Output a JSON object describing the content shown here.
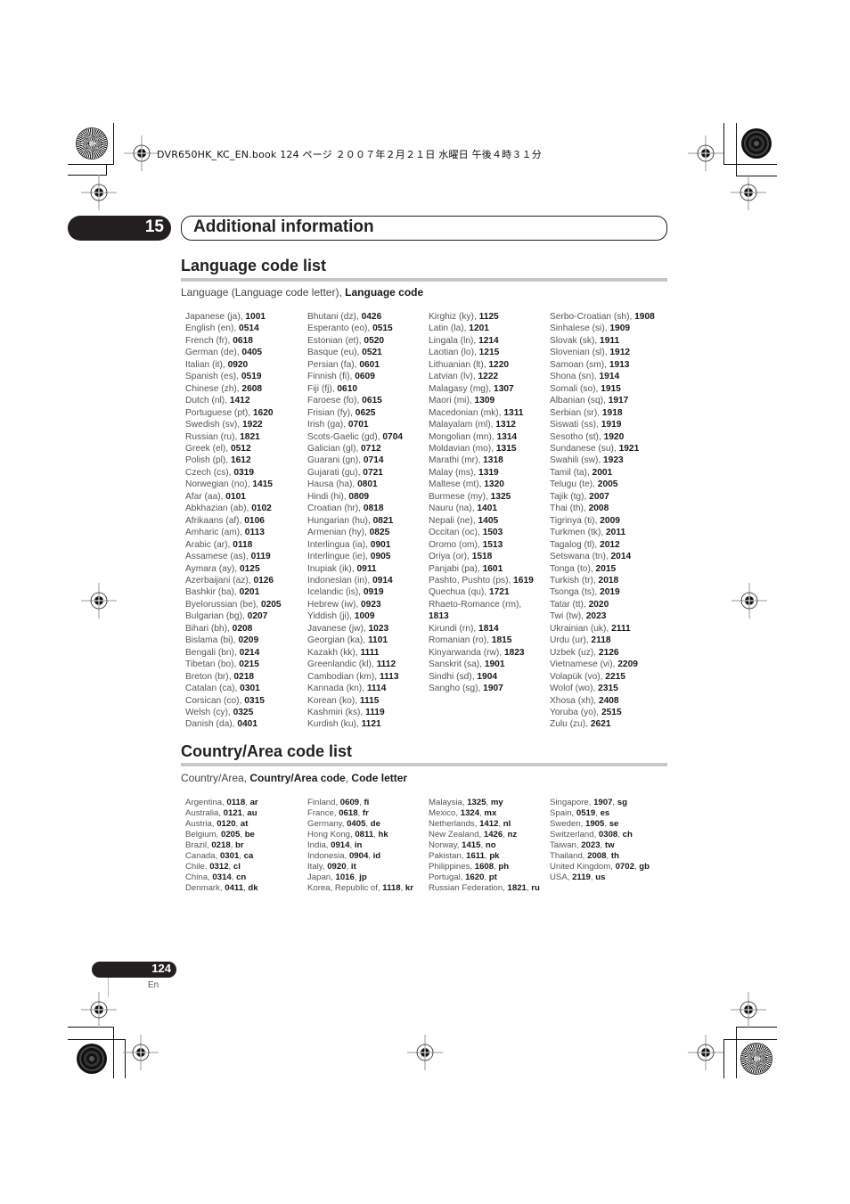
{
  "header": {
    "file_info": "DVR650HK_KC_EN.book  124 ページ  ２００７年２月２１日  水曜日  午後４時３１分"
  },
  "chapter": {
    "number": "15",
    "title": "Additional information"
  },
  "language_section": {
    "title": "Language code list",
    "subhead_plain": "Language (Language code letter), ",
    "subhead_bold": "Language code",
    "columns": [
      [
        {
          "name": "Japanese (ja), ",
          "code": "1001"
        },
        {
          "name": "English (en), ",
          "code": "0514"
        },
        {
          "name": "French (fr), ",
          "code": "0618"
        },
        {
          "name": "German (de), ",
          "code": "0405"
        },
        {
          "name": "Italian (it), ",
          "code": "0920"
        },
        {
          "name": "Spanish (es), ",
          "code": "0519"
        },
        {
          "name": "Chinese (zh), ",
          "code": "2608"
        },
        {
          "name": "Dutch (nl), ",
          "code": "1412"
        },
        {
          "name": "Portuguese (pt), ",
          "code": "1620"
        },
        {
          "name": "Swedish (sv), ",
          "code": "1922"
        },
        {
          "name": "Russian (ru), ",
          "code": "1821"
        },
        {
          "name": "Greek (el), ",
          "code": "0512"
        },
        {
          "name": "Polish (pl), ",
          "code": "1612"
        },
        {
          "name": "Czech (cs), ",
          "code": "0319"
        },
        {
          "name": "Norwegian (no), ",
          "code": "1415"
        },
        {
          "name": "Afar (aa), ",
          "code": "0101"
        },
        {
          "name": "Abkhazian (ab), ",
          "code": "0102"
        },
        {
          "name": "Afrikaans (af), ",
          "code": "0106"
        },
        {
          "name": "Amharic (am), ",
          "code": "0113"
        },
        {
          "name": "Arabic (ar), ",
          "code": "0118"
        },
        {
          "name": "Assamese (as), ",
          "code": "0119"
        },
        {
          "name": "Aymara (ay), ",
          "code": "0125"
        },
        {
          "name": "Azerbaijani (az), ",
          "code": "0126"
        },
        {
          "name": "Bashkir (ba), ",
          "code": "0201"
        },
        {
          "name": "Byelorussian (be), ",
          "code": "0205"
        },
        {
          "name": "Bulgarian (bg), ",
          "code": "0207"
        },
        {
          "name": "Bihari (bh), ",
          "code": "0208"
        },
        {
          "name": "Bislama (bi), ",
          "code": "0209"
        },
        {
          "name": "Bengali (bn), ",
          "code": "0214"
        },
        {
          "name": "Tibetan (bo), ",
          "code": "0215"
        },
        {
          "name": "Breton (br), ",
          "code": "0218"
        },
        {
          "name": "Catalan (ca), ",
          "code": "0301"
        },
        {
          "name": "Corsican (co), ",
          "code": "0315"
        },
        {
          "name": "Welsh (cy), ",
          "code": "0325"
        },
        {
          "name": "Danish (da), ",
          "code": "0401"
        }
      ],
      [
        {
          "name": "Bhutani (dz), ",
          "code": "0426"
        },
        {
          "name": "Esperanto (eo), ",
          "code": "0515"
        },
        {
          "name": "Estonian (et), ",
          "code": "0520"
        },
        {
          "name": "Basque (eu), ",
          "code": "0521"
        },
        {
          "name": "Persian (fa), ",
          "code": "0601"
        },
        {
          "name": "Finnish (fi), ",
          "code": "0609"
        },
        {
          "name": "Fiji (fj), ",
          "code": "0610"
        },
        {
          "name": "Faroese (fo), ",
          "code": "0615"
        },
        {
          "name": "Frisian (fy), ",
          "code": "0625"
        },
        {
          "name": "Irish (ga), ",
          "code": "0701"
        },
        {
          "name": "Scots-Gaelic (gd), ",
          "code": "0704"
        },
        {
          "name": "Galician (gl), ",
          "code": "0712"
        },
        {
          "name": "Guarani (gn), ",
          "code": "0714"
        },
        {
          "name": "Gujarati (gu), ",
          "code": "0721"
        },
        {
          "name": "Hausa (ha), ",
          "code": "0801"
        },
        {
          "name": "Hindi (hi), ",
          "code": "0809"
        },
        {
          "name": "Croatian (hr), ",
          "code": "0818"
        },
        {
          "name": "Hungarian (hu), ",
          "code": "0821"
        },
        {
          "name": "Armenian (hy), ",
          "code": "0825"
        },
        {
          "name": "Interlingua (ia), ",
          "code": "0901"
        },
        {
          "name": "Interlingue (ie), ",
          "code": "0905"
        },
        {
          "name": "Inupiak (ik), ",
          "code": "0911"
        },
        {
          "name": "Indonesian (in), ",
          "code": "0914"
        },
        {
          "name": "Icelandic (is), ",
          "code": "0919"
        },
        {
          "name": "Hebrew (iw), ",
          "code": "0923"
        },
        {
          "name": "Yiddish (ji), ",
          "code": "1009"
        },
        {
          "name": "Javanese (jw), ",
          "code": "1023"
        },
        {
          "name": "Georgian (ka), ",
          "code": "1101"
        },
        {
          "name": "Kazakh (kk), ",
          "code": "1111"
        },
        {
          "name": "Greenlandic (kl), ",
          "code": "1112"
        },
        {
          "name": "Cambodian (km), ",
          "code": "1113"
        },
        {
          "name": "Kannada (kn), ",
          "code": "1114"
        },
        {
          "name": "Korean (ko), ",
          "code": "1115"
        },
        {
          "name": "Kashmiri (ks), ",
          "code": "1119"
        },
        {
          "name": "Kurdish (ku), ",
          "code": "1121"
        }
      ],
      [
        {
          "name": "Kirghiz (ky), ",
          "code": "1125"
        },
        {
          "name": "Latin (la), ",
          "code": "1201"
        },
        {
          "name": "Lingala (ln), ",
          "code": "1214"
        },
        {
          "name": "Laotian (lo), ",
          "code": "1215"
        },
        {
          "name": "Lithuanian (lt), ",
          "code": "1220"
        },
        {
          "name": "Latvian (lv), ",
          "code": "1222"
        },
        {
          "name": "Malagasy (mg), ",
          "code": "1307"
        },
        {
          "name": "Maori (mi), ",
          "code": "1309"
        },
        {
          "name": "Macedonian (mk), ",
          "code": "1311"
        },
        {
          "name": "Malayalam (ml), ",
          "code": "1312"
        },
        {
          "name": "Mongolian (mn), ",
          "code": "1314"
        },
        {
          "name": "Moldavian (mo), ",
          "code": "1315"
        },
        {
          "name": "Marathi (mr), ",
          "code": "1318"
        },
        {
          "name": "Malay (ms), ",
          "code": "1319"
        },
        {
          "name": "Maltese (mt), ",
          "code": "1320"
        },
        {
          "name": "Burmese (my), ",
          "code": "1325"
        },
        {
          "name": "Nauru (na), ",
          "code": "1401"
        },
        {
          "name": "Nepali (ne), ",
          "code": "1405"
        },
        {
          "name": "Occitan (oc), ",
          "code": "1503"
        },
        {
          "name": "Oromo (om), ",
          "code": "1513"
        },
        {
          "name": "Oriya (or), ",
          "code": "1518"
        },
        {
          "name": "Panjabi (pa), ",
          "code": "1601"
        },
        {
          "name": "Pashto, Pushto (ps), ",
          "code": "1619"
        },
        {
          "name": "Quechua (qu), ",
          "code": "1721"
        },
        {
          "name": "Rhaeto-Romance (rm), ",
          "code": ""
        },
        {
          "name": "",
          "code": "1813"
        },
        {
          "name": "Kirundi (rn), ",
          "code": "1814"
        },
        {
          "name": "Romanian (ro), ",
          "code": "1815"
        },
        {
          "name": "Kinyarwanda (rw), ",
          "code": "1823"
        },
        {
          "name": "Sanskrit (sa), ",
          "code": "1901"
        },
        {
          "name": "Sindhi (sd), ",
          "code": "1904"
        },
        {
          "name": "Sangho (sg), ",
          "code": "1907"
        }
      ],
      [
        {
          "name": "Serbo-Croatian (sh), ",
          "code": "1908"
        },
        {
          "name": "Sinhalese (si), ",
          "code": "1909"
        },
        {
          "name": "Slovak (sk), ",
          "code": "1911"
        },
        {
          "name": "Slovenian (sl), ",
          "code": "1912"
        },
        {
          "name": "Samoan (sm), ",
          "code": "1913"
        },
        {
          "name": "Shona (sn), ",
          "code": "1914"
        },
        {
          "name": "Somali (so), ",
          "code": "1915"
        },
        {
          "name": "Albanian (sq), ",
          "code": "1917"
        },
        {
          "name": "Serbian (sr), ",
          "code": "1918"
        },
        {
          "name": "Siswati (ss), ",
          "code": "1919"
        },
        {
          "name": "Sesotho (st), ",
          "code": "1920"
        },
        {
          "name": "Sundanese (su), ",
          "code": "1921"
        },
        {
          "name": "Swahili (sw), ",
          "code": "1923"
        },
        {
          "name": "Tamil (ta), ",
          "code": "2001"
        },
        {
          "name": "Telugu (te), ",
          "code": "2005"
        },
        {
          "name": "Tajik (tg), ",
          "code": "2007"
        },
        {
          "name": "Thai (th), ",
          "code": "2008"
        },
        {
          "name": "Tigrinya (ti), ",
          "code": "2009"
        },
        {
          "name": "Turkmen (tk), ",
          "code": "2011"
        },
        {
          "name": "Tagalog (tl), ",
          "code": "2012"
        },
        {
          "name": "Setswana (tn), ",
          "code": "2014"
        },
        {
          "name": "Tonga (to), ",
          "code": "2015"
        },
        {
          "name": "Turkish (tr), ",
          "code": "2018"
        },
        {
          "name": "Tsonga (ts), ",
          "code": "2019"
        },
        {
          "name": "Tatar (tt), ",
          "code": "2020"
        },
        {
          "name": "Twi (tw), ",
          "code": "2023"
        },
        {
          "name": "Ukrainian (uk), ",
          "code": "2111"
        },
        {
          "name": "Urdu (ur), ",
          "code": "2118"
        },
        {
          "name": "Uzbek (uz), ",
          "code": "2126"
        },
        {
          "name": "Vietnamese (vi), ",
          "code": "2209"
        },
        {
          "name": "Volapük (vo), ",
          "code": "2215"
        },
        {
          "name": "Wolof (wo), ",
          "code": "2315"
        },
        {
          "name": "Xhosa (xh), ",
          "code": "2408"
        },
        {
          "name": "Yoruba (yo), ",
          "code": "2515"
        },
        {
          "name": "Zulu (zu), ",
          "code": "2621"
        }
      ]
    ]
  },
  "country_section": {
    "title": "Country/Area code list",
    "subhead_plain": "Country/Area, ",
    "subhead_bold1": "Country/Area code",
    "subhead_sep": ", ",
    "subhead_bold2": "Code letter",
    "columns": [
      [
        {
          "name": "Argentina, ",
          "code": "0118",
          "letter": "ar"
        },
        {
          "name": "Australia, ",
          "code": "0121",
          "letter": "au"
        },
        {
          "name": "Austria, ",
          "code": "0120",
          "letter": "at"
        },
        {
          "name": "Belgium, ",
          "code": "0205",
          "letter": "be"
        },
        {
          "name": "Brazil, ",
          "code": "0218",
          "letter": "br"
        },
        {
          "name": "Canada, ",
          "code": "0301",
          "letter": "ca"
        },
        {
          "name": "Chile, ",
          "code": "0312",
          "letter": "cl"
        },
        {
          "name": "China, ",
          "code": "0314",
          "letter": "cn"
        },
        {
          "name": "Denmark, ",
          "code": "0411",
          "letter": "dk"
        }
      ],
      [
        {
          "name": "Finland, ",
          "code": "0609",
          "letter": "fi"
        },
        {
          "name": "France, ",
          "code": "0618",
          "letter": "fr"
        },
        {
          "name": "Germany, ",
          "code": "0405",
          "letter": "de"
        },
        {
          "name": "Hong Kong, ",
          "code": "0811",
          "letter": "hk"
        },
        {
          "name": "India, ",
          "code": "0914",
          "letter": "in"
        },
        {
          "name": "Indonesia, ",
          "code": "0904",
          "letter": "id"
        },
        {
          "name": "Italy, ",
          "code": "0920",
          "letter": "it"
        },
        {
          "name": "Japan, ",
          "code": "1016",
          "letter": "jp"
        },
        {
          "name": "Korea, Republic of, ",
          "code": "1118",
          "letter": "kr"
        }
      ],
      [
        {
          "name": "Malaysia, ",
          "code": "1325",
          "letter": "my"
        },
        {
          "name": "Mexico, ",
          "code": "1324",
          "letter": "mx"
        },
        {
          "name": "Netherlands, ",
          "code": "1412",
          "letter": "nl"
        },
        {
          "name": "New Zealand, ",
          "code": "1426",
          "letter": "nz"
        },
        {
          "name": "Norway, ",
          "code": "1415",
          "letter": "no"
        },
        {
          "name": "Pakistan, ",
          "code": "1611",
          "letter": "pk"
        },
        {
          "name": "Philippines, ",
          "code": "1608",
          "letter": "ph"
        },
        {
          "name": "Portugal, ",
          "code": "1620",
          "letter": "pt"
        },
        {
          "name": "Russian Federation, ",
          "code": "1821",
          "letter": "ru"
        }
      ],
      [
        {
          "name": "Singapore, ",
          "code": "1907",
          "letter": "sg"
        },
        {
          "name": "Spain, ",
          "code": "0519",
          "letter": "es"
        },
        {
          "name": "Sweden, ",
          "code": "1905",
          "letter": "se"
        },
        {
          "name": "Switzerland, ",
          "code": "0308",
          "letter": "ch"
        },
        {
          "name": "Taiwan, ",
          "code": "2023",
          "letter": "tw"
        },
        {
          "name": "Thailand, ",
          "code": "2008",
          "letter": "th"
        },
        {
          "name": "United Kingdom, ",
          "code": "0702",
          "letter": "gb"
        },
        {
          "name": "USA, ",
          "code": "2119",
          "letter": "us"
        }
      ]
    ]
  },
  "footer": {
    "page_number": "124",
    "language": "En"
  }
}
